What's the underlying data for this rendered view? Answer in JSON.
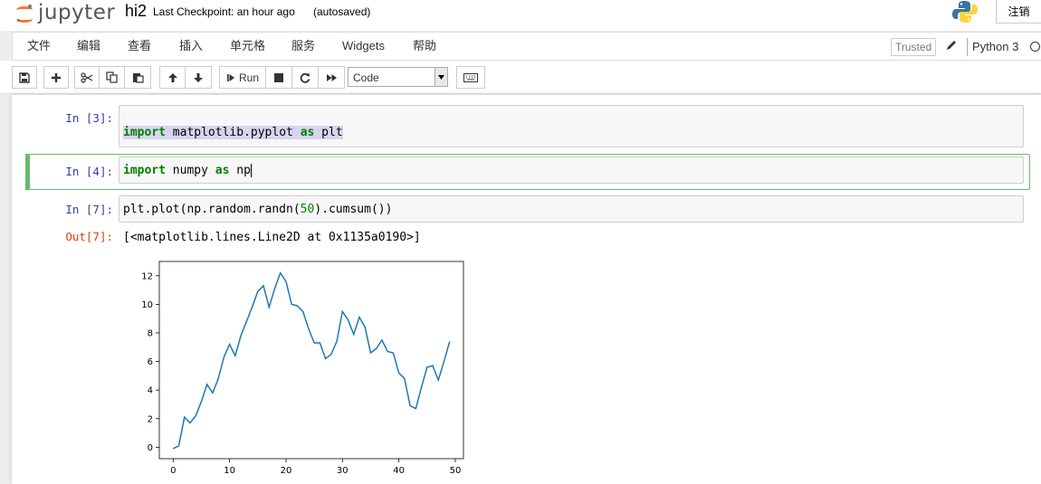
{
  "header": {
    "logo_text": "jupyter",
    "notebook_name": "hi2",
    "checkpoint": "Last Checkpoint: an hour ago",
    "autosaved": "(autosaved)",
    "logout_label": "注销"
  },
  "menubar": {
    "items": [
      "文件",
      "编辑",
      "查看",
      "插入",
      "单元格",
      "服务",
      "Widgets",
      "帮助"
    ],
    "trusted": "Trusted",
    "kernel_name": "Python 3"
  },
  "toolbar": {
    "run_label": "Run",
    "cell_type": "Code"
  },
  "cells": [
    {
      "prompt": "In [3]:",
      "code": [
        "import",
        " matplotlib.pyplot ",
        "as",
        " plt"
      ]
    },
    {
      "prompt": "In [4]:",
      "code": [
        "import",
        " numpy ",
        "as",
        " np"
      ]
    },
    {
      "prompt": "In [7]:",
      "code": [
        "plt.plot(np.random.randn(",
        "50",
        ").cumsum())"
      ]
    }
  ],
  "output": {
    "prompt": "Out[7]:",
    "text": "[<matplotlib.lines.Line2D at 0x1135a0190>]"
  },
  "colors": {
    "accent_green": "#66bb6a",
    "line_blue": "#1f77b4",
    "prompt_in": "#303f9f",
    "prompt_out": "#d84315"
  },
  "chart_data": {
    "type": "line",
    "xlim": [
      -2.45,
      51.45
    ],
    "ylim": [
      -0.8,
      13.0
    ],
    "xticks": [
      0,
      10,
      20,
      30,
      40,
      50
    ],
    "yticks": [
      0,
      2,
      4,
      6,
      8,
      10,
      12
    ],
    "grid": false,
    "series": [
      {
        "values": [
          -0.1,
          0.1,
          2.1,
          1.7,
          2.2,
          3.2,
          4.4,
          3.8,
          4.8,
          6.3,
          7.2,
          6.4,
          7.8,
          8.8,
          9.8,
          10.9,
          11.3,
          9.8,
          11.1,
          12.2,
          11.6,
          10.0,
          9.9,
          9.5,
          8.3,
          7.3,
          7.3,
          6.2,
          6.5,
          7.4,
          9.5,
          8.9,
          7.9,
          9.1,
          8.4,
          6.6,
          6.9,
          7.5,
          6.7,
          6.6,
          5.2,
          4.8,
          2.9,
          2.7,
          4.2,
          5.6,
          5.7,
          4.7,
          6.0,
          7.4
        ]
      }
    ]
  }
}
